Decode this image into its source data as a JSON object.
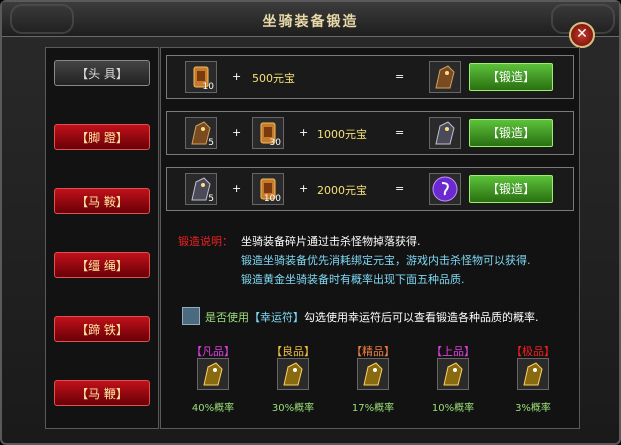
{
  "window": {
    "title": "坐骑装备锻造",
    "close": "✕"
  },
  "sidebar": {
    "items": [
      {
        "label": "【头 具】",
        "state": "active"
      },
      {
        "label": "【脚 蹬】",
        "state": "red"
      },
      {
        "label": "【马 鞍】",
        "state": "red"
      },
      {
        "label": "【缰 绳】",
        "state": "red"
      },
      {
        "label": "【蹄 铁】",
        "state": "red"
      },
      {
        "label": "【马 鞭】",
        "state": "red"
      }
    ]
  },
  "recipes": [
    {
      "inputs": [
        {
          "icon": "fragment-icon",
          "count": "10"
        }
      ],
      "cost": "500元宝",
      "result_icon": "bronze-horse-armor-icon",
      "button": "【锻造】"
    },
    {
      "inputs": [
        {
          "icon": "bronze-horse-armor-icon",
          "count": "5"
        },
        {
          "icon": "fragment-icon",
          "count": "30"
        }
      ],
      "cost": "1000元宝",
      "result_icon": "silver-horse-armor-icon",
      "button": "【锻造】"
    },
    {
      "inputs": [
        {
          "icon": "silver-horse-armor-icon",
          "count": "5"
        },
        {
          "icon": "fragment-icon",
          "count": "100"
        }
      ],
      "cost": "2000元宝",
      "result_icon": "purple-orb-icon",
      "button": "【锻造】"
    }
  ],
  "symbols": {
    "plus": "+",
    "equals": "="
  },
  "description": {
    "label": "锻造说明：",
    "line1": "坐骑装备碎片通过击杀怪物掉落获得.",
    "line2": "锻造坐骑装备优先消耗绑定元宝，游戏内击杀怪物可以获得.",
    "line3": "锻造黄金坐骑装备时有概率出现下面五种品质."
  },
  "luck": {
    "prefix": "是否使用",
    "item": "【幸运符】",
    "suffix": "勾选使用幸运符后可以查看锻造各种品质的概率."
  },
  "qualities": [
    {
      "name": "【凡品】",
      "color": "#e040e0",
      "rate": "40%概率"
    },
    {
      "name": "【良品】",
      "color": "#f0c040",
      "rate": "30%概率"
    },
    {
      "name": "【精品】",
      "color": "#f08040",
      "rate": "17%概率"
    },
    {
      "name": "【上品】",
      "color": "#e040e0",
      "rate": "10%概率"
    },
    {
      "name": "【极品】",
      "color": "#f02020",
      "rate": "3%概率"
    }
  ],
  "colors": {
    "cost": "#f4e07a",
    "desc_label": "#f02020",
    "desc_text": "#7fd9f5",
    "rate": "#9be07a"
  }
}
